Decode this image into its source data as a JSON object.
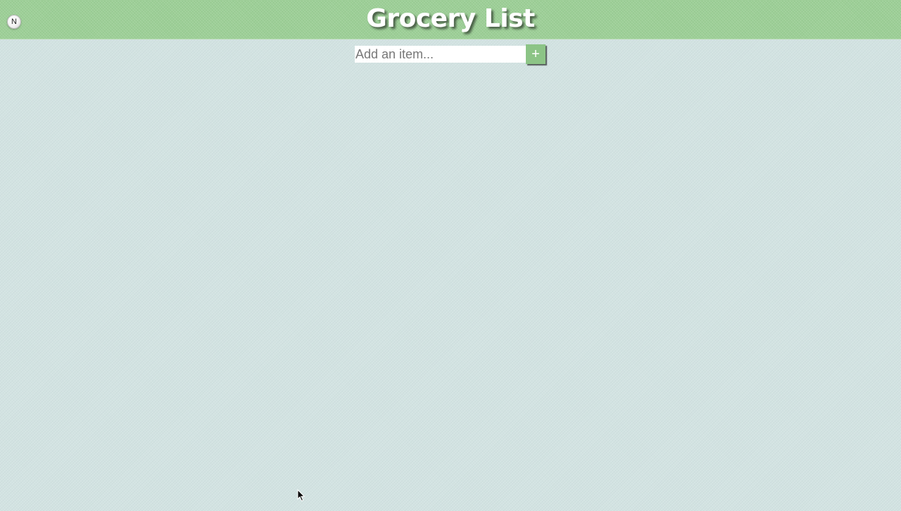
{
  "header": {
    "title": "Grocery List",
    "badge_label": "N",
    "badge_icon": "n-badge-icon"
  },
  "add_item": {
    "placeholder": "Add an item...",
    "value": "",
    "button_label": "+",
    "button_icon": "plus-icon"
  },
  "items": [],
  "colors": {
    "header_green": "#9dcf97",
    "background": "#d3e3e2",
    "button_green": "#8cc486",
    "title_text": "#ffffff"
  }
}
